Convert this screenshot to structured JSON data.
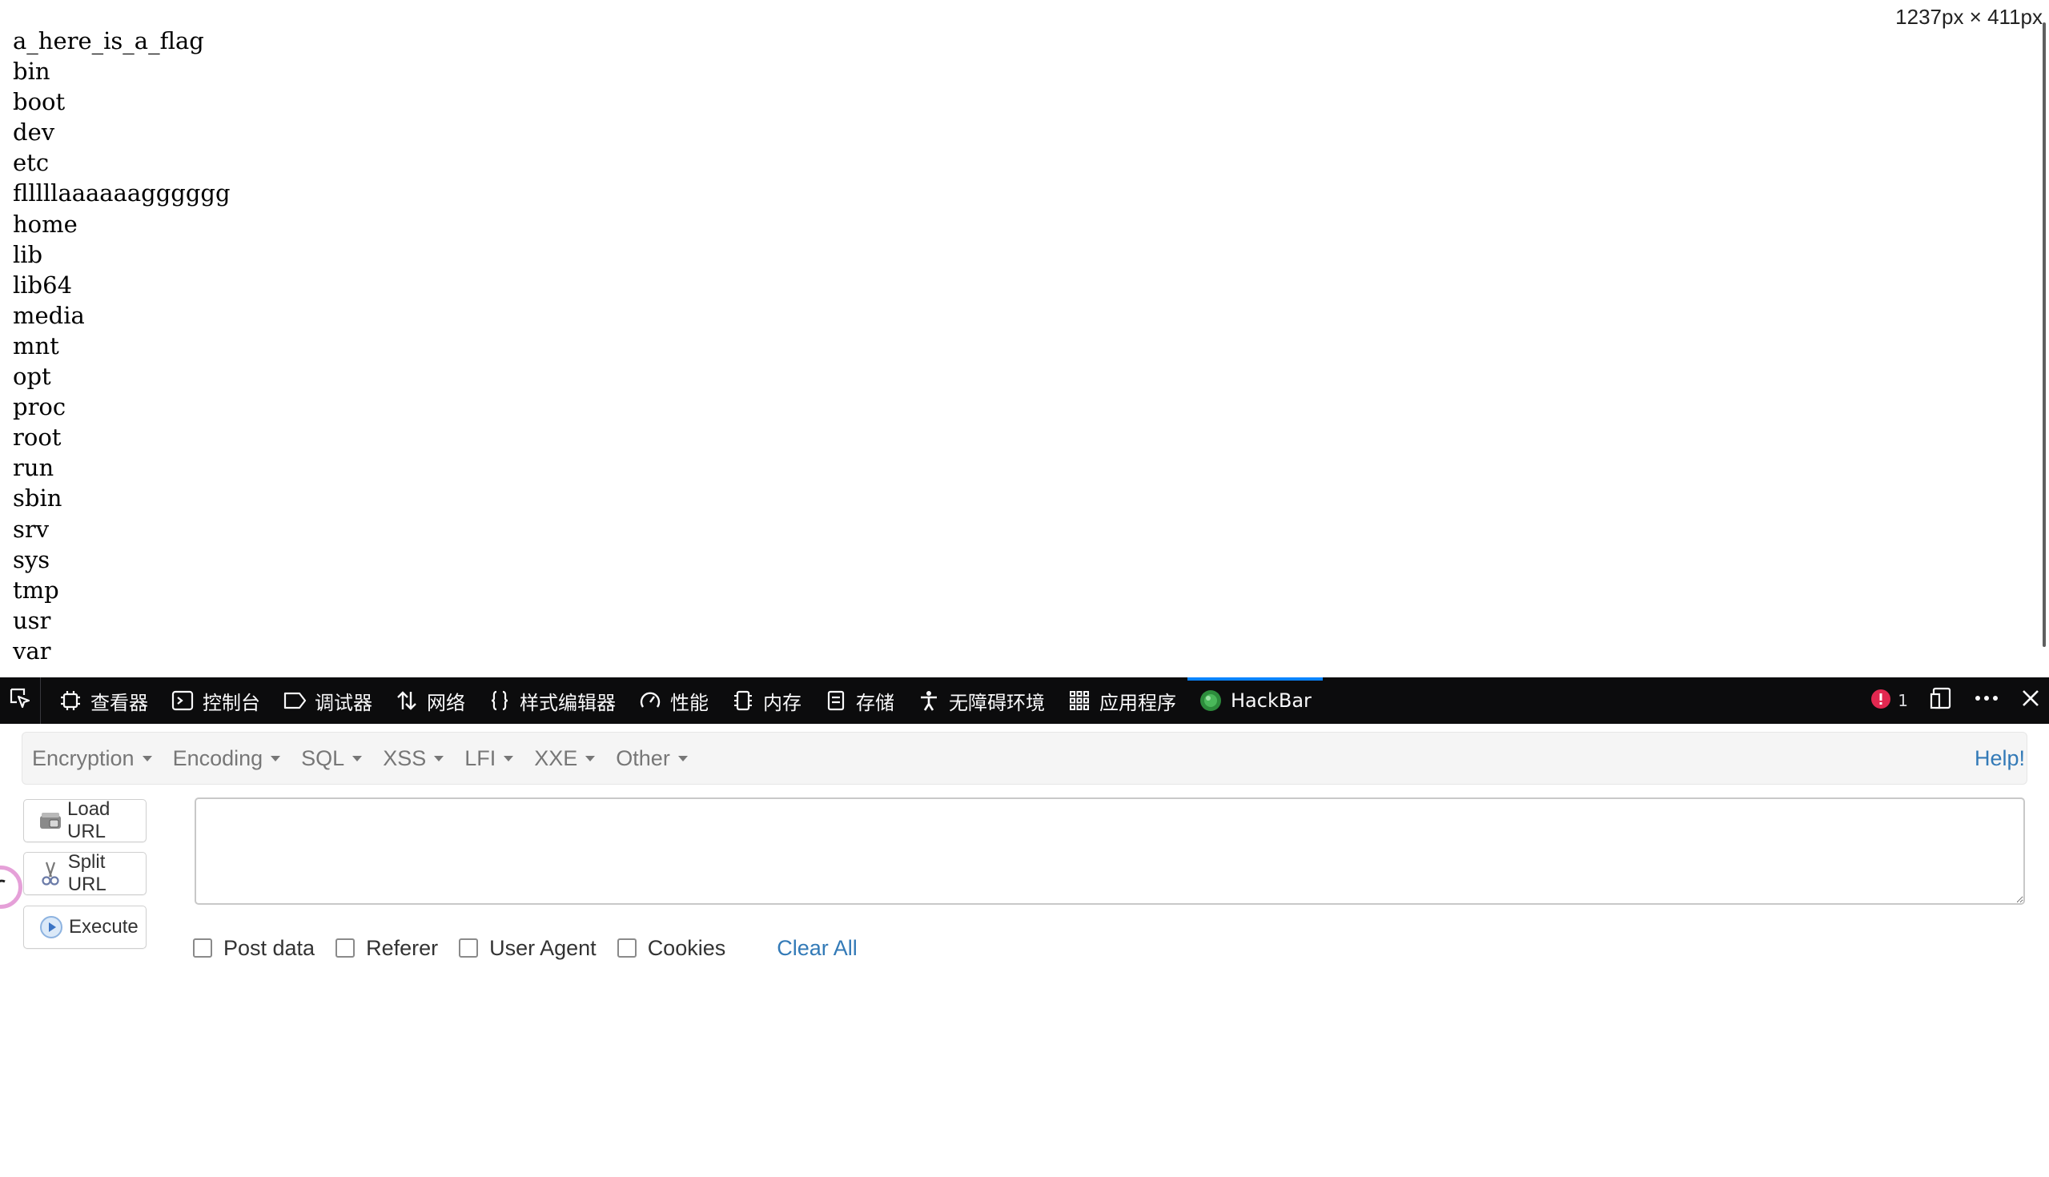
{
  "page": {
    "size_indicator": "1237px × 411px",
    "directory_entries": [
      "a_here_is_a_flag",
      "bin",
      "boot",
      "dev",
      "etc",
      "flllllaaaaaagggggg",
      "home",
      "lib",
      "lib64",
      "media",
      "mnt",
      "opt",
      "proc",
      "root",
      "run",
      "sbin",
      "srv",
      "sys",
      "tmp",
      "usr",
      "var"
    ]
  },
  "devtools": {
    "tabs": [
      {
        "label": "查看器",
        "icon": "inspector-icon"
      },
      {
        "label": "控制台",
        "icon": "console-icon"
      },
      {
        "label": "调试器",
        "icon": "debugger-icon"
      },
      {
        "label": "网络",
        "icon": "network-icon"
      },
      {
        "label": "样式编辑器",
        "icon": "style-editor-icon"
      },
      {
        "label": "性能",
        "icon": "performance-icon"
      },
      {
        "label": "内存",
        "icon": "memory-icon"
      },
      {
        "label": "存储",
        "icon": "storage-icon"
      },
      {
        "label": "无障碍环境",
        "icon": "accessibility-icon"
      },
      {
        "label": "应用程序",
        "icon": "application-icon"
      },
      {
        "label": "HackBar",
        "icon": "hackbar-icon"
      }
    ],
    "active_tab": "HackBar",
    "error_count": "1",
    "accent_color": "#0a84ff",
    "error_color": "#e22850"
  },
  "hackbar": {
    "menu": {
      "items": [
        "Encryption",
        "Encoding",
        "SQL",
        "XSS",
        "LFI",
        "XXE",
        "Other"
      ],
      "help": "Help!"
    },
    "buttons": {
      "load_url": "Load URL",
      "split_url": "Split URL",
      "execute": "Execute"
    },
    "url_value": "",
    "options": {
      "post_data": "Post data",
      "referer": "Referer",
      "user_agent": "User Agent",
      "cookies": "Cookies"
    },
    "clear_all": "Clear All",
    "link_color": "#337ab7"
  }
}
